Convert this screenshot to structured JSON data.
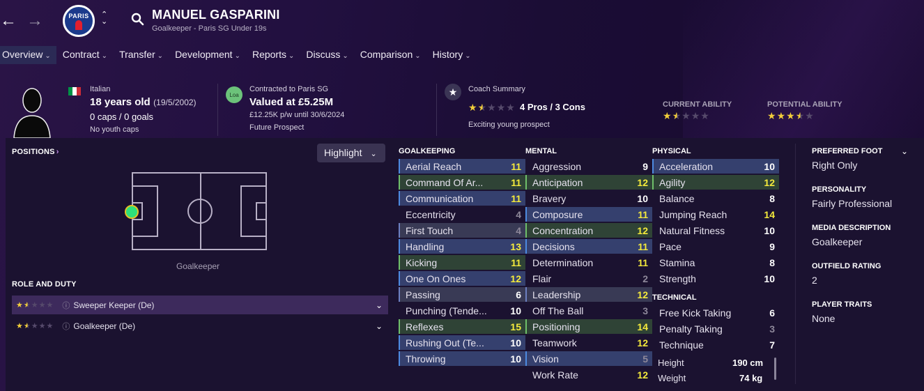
{
  "header": {
    "back_icon": "arrow-left-icon",
    "forward_icon": "arrow-right-icon",
    "club_crest_text": "PARIS",
    "name": "MANUEL GASPARINI",
    "subtitle": "Goalkeeper - Paris SG Under 19s"
  },
  "menu": [
    {
      "label": "Overview",
      "active": true
    },
    {
      "label": "Contract"
    },
    {
      "label": "Transfer"
    },
    {
      "label": "Development"
    },
    {
      "label": "Reports"
    },
    {
      "label": "Discuss"
    },
    {
      "label": "Comparison"
    },
    {
      "label": "History"
    }
  ],
  "profile": {
    "nationality": "Italian",
    "age": "18 years old",
    "dob": "(19/5/2002)",
    "caps": "0 caps / 0 goals",
    "youth_caps": "No youth caps",
    "flag_colors": [
      "#009246",
      "#ffffff",
      "#ce2b37"
    ]
  },
  "contract": {
    "badge": "Loa",
    "contracted_to": "Contracted to Paris SG",
    "value": "Valued at £5.25M",
    "wage": "£12.25K p/w until 30/6/2024",
    "prospect": "Future Prospect"
  },
  "coach": {
    "label": "Coach Summary",
    "stars": 1.5,
    "summary": "4 Pros / 3 Cons",
    "text": "Exciting young prospect"
  },
  "ability": {
    "current_label": "CURRENT ABILITY",
    "current_stars": 1.5,
    "potential_label": "POTENTIAL ABILITY",
    "potential_stars": 3.5
  },
  "positions": {
    "title": "POSITIONS",
    "highlight": "Highlight",
    "position_label": "Goalkeeper"
  },
  "roles": {
    "title": "ROLE AND DUTY",
    "items": [
      {
        "stars": 1.5,
        "label": "Sweeper Keeper (De)",
        "selected": true
      },
      {
        "stars": 1.5,
        "label": "Goalkeeper (De)",
        "selected": false
      }
    ]
  },
  "goalkeeping": {
    "title": "GOALKEEPING",
    "rows": [
      {
        "label": "Aerial Reach",
        "value": "11",
        "hl": "b",
        "c": "y"
      },
      {
        "label": "Command Of Ar...",
        "value": "11",
        "hl": "g",
        "c": "y"
      },
      {
        "label": "Communication",
        "value": "11",
        "hl": "b",
        "c": "y"
      },
      {
        "label": "Eccentricity",
        "value": "4",
        "hl": "",
        "c": "d"
      },
      {
        "label": "First Touch",
        "value": "4",
        "hl": "p",
        "c": "d"
      },
      {
        "label": "Handling",
        "value": "13",
        "hl": "b",
        "c": "y"
      },
      {
        "label": "Kicking",
        "value": "11",
        "hl": "g",
        "c": "y"
      },
      {
        "label": "One On Ones",
        "value": "12",
        "hl": "b",
        "c": "y"
      },
      {
        "label": "Passing",
        "value": "6",
        "hl": "p",
        "c": ""
      },
      {
        "label": "Punching (Tende...",
        "value": "10",
        "hl": "",
        "c": ""
      },
      {
        "label": "Reflexes",
        "value": "15",
        "hl": "g",
        "c": "y"
      },
      {
        "label": "Rushing Out (Te...",
        "value": "10",
        "hl": "b",
        "c": ""
      },
      {
        "label": "Throwing",
        "value": "10",
        "hl": "b",
        "c": ""
      }
    ]
  },
  "mental": {
    "title": "MENTAL",
    "rows": [
      {
        "label": "Aggression",
        "value": "9",
        "hl": "",
        "c": ""
      },
      {
        "label": "Anticipation",
        "value": "12",
        "hl": "g",
        "c": "y"
      },
      {
        "label": "Bravery",
        "value": "10",
        "hl": "",
        "c": ""
      },
      {
        "label": "Composure",
        "value": "11",
        "hl": "b",
        "c": "y"
      },
      {
        "label": "Concentration",
        "value": "12",
        "hl": "g",
        "c": "y"
      },
      {
        "label": "Decisions",
        "value": "11",
        "hl": "b",
        "c": "y"
      },
      {
        "label": "Determination",
        "value": "11",
        "hl": "",
        "c": "y"
      },
      {
        "label": "Flair",
        "value": "2",
        "hl": "",
        "c": "d"
      },
      {
        "label": "Leadership",
        "value": "12",
        "hl": "p",
        "c": "y"
      },
      {
        "label": "Off The Ball",
        "value": "3",
        "hl": "",
        "c": "d"
      },
      {
        "label": "Positioning",
        "value": "14",
        "hl": "g",
        "c": "y"
      },
      {
        "label": "Teamwork",
        "value": "12",
        "hl": "",
        "c": "y"
      },
      {
        "label": "Vision",
        "value": "5",
        "hl": "b",
        "c": "d"
      },
      {
        "label": "Work Rate",
        "value": "12",
        "hl": "",
        "c": "y"
      }
    ]
  },
  "physical": {
    "title": "PHYSICAL",
    "rows": [
      {
        "label": "Acceleration",
        "value": "10",
        "hl": "b",
        "c": ""
      },
      {
        "label": "Agility",
        "value": "12",
        "hl": "g",
        "c": "y"
      },
      {
        "label": "Balance",
        "value": "8",
        "hl": "",
        "c": ""
      },
      {
        "label": "Jumping Reach",
        "value": "14",
        "hl": "",
        "c": "y"
      },
      {
        "label": "Natural Fitness",
        "value": "10",
        "hl": "",
        "c": ""
      },
      {
        "label": "Pace",
        "value": "9",
        "hl": "",
        "c": ""
      },
      {
        "label": "Stamina",
        "value": "8",
        "hl": "",
        "c": ""
      },
      {
        "label": "Strength",
        "value": "10",
        "hl": "",
        "c": ""
      }
    ]
  },
  "technical": {
    "title": "TECHNICAL",
    "rows": [
      {
        "label": "Free Kick Taking",
        "value": "6",
        "hl": "",
        "c": ""
      },
      {
        "label": "Penalty Taking",
        "value": "3",
        "hl": "",
        "c": "d"
      },
      {
        "label": "Technique",
        "value": "7",
        "hl": "",
        "c": ""
      }
    ]
  },
  "body": {
    "height_label": "Height",
    "height": "190 cm",
    "weight_label": "Weight",
    "weight": "74 kg"
  },
  "right": [
    {
      "label": "PREFERRED FOOT",
      "value": "Right Only"
    },
    {
      "label": "PERSONALITY",
      "value": "Fairly Professional"
    },
    {
      "label": "MEDIA DESCRIPTION",
      "value": "Goalkeeper"
    },
    {
      "label": "OUTFIELD RATING",
      "value": "2"
    },
    {
      "label": "PLAYER TRAITS",
      "value": "None"
    }
  ]
}
